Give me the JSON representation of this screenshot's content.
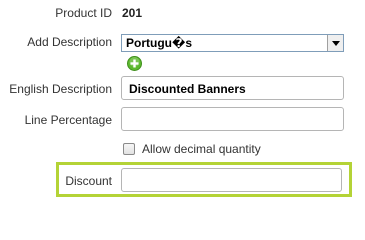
{
  "product_id": {
    "label": "Product ID",
    "value": "201"
  },
  "add_description": {
    "label": "Add Description",
    "selected_option": "Portugu�s",
    "add_icon": "plus-circle-icon"
  },
  "english_description": {
    "label": "English Description",
    "value": "Discounted Banners"
  },
  "line_percentage": {
    "label": "Line Percentage",
    "value": ""
  },
  "allow_decimal": {
    "label": "Allow decimal quantity",
    "checked": false
  },
  "discount": {
    "label": "Discount",
    "value": ""
  },
  "colors": {
    "highlight_border": "#b4d336",
    "add_icon_green": "#5cb82e"
  }
}
